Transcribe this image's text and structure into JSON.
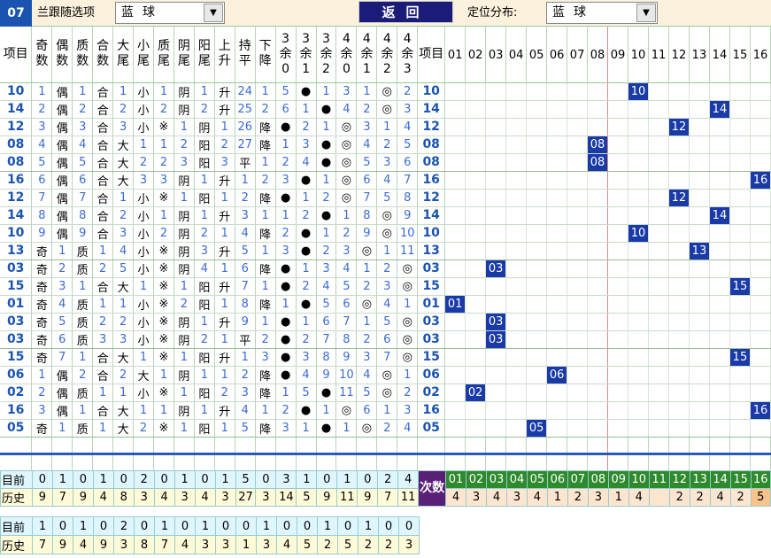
{
  "topbar": {
    "issue": "07",
    "title": "兰跟随选项",
    "ball_select": "蓝球",
    "back_label": "返回",
    "dist_label": "定位分布:",
    "dist_select": "蓝球",
    "arrow": "▼"
  },
  "headers": [
    "项目",
    "奇数",
    "偶数",
    "质数",
    "合数",
    "大尾",
    "小尾",
    "质尾",
    "阴尾",
    "阳尾",
    "上升",
    "持平",
    "下降",
    "3余0",
    "3余1",
    "3余2",
    "4余0",
    "4余1",
    "4余2",
    "4余3",
    "项目"
  ],
  "number_headers": [
    "01",
    "02",
    "03",
    "04",
    "05",
    "06",
    "07",
    "08",
    "09",
    "10",
    "11",
    "12",
    "13",
    "14",
    "15",
    "16"
  ],
  "rows": [
    {
      "no": "10",
      "c": [
        "1",
        "偶",
        "1",
        "合",
        "1",
        "小",
        "1",
        "阴",
        "1",
        "升",
        "24",
        "1",
        "5",
        "●",
        "1",
        "3",
        "1",
        "◎",
        "2"
      ]
    },
    {
      "no": "14",
      "c": [
        "2",
        "偶",
        "2",
        "合",
        "2",
        "小",
        "2",
        "阴",
        "2",
        "升",
        "25",
        "2",
        "6",
        "1",
        "●",
        "4",
        "2",
        "◎",
        "3"
      ]
    },
    {
      "no": "12",
      "c": [
        "3",
        "偶",
        "3",
        "合",
        "3",
        "小",
        "※",
        "1",
        "阴",
        "1",
        "26",
        "降",
        "●",
        "2",
        "1",
        "◎",
        "3",
        "1",
        "4"
      ]
    },
    {
      "no": "08",
      "c": [
        "4",
        "偶",
        "4",
        "合",
        "大",
        "1",
        "1",
        "2",
        "阳",
        "2",
        "27",
        "降",
        "1",
        "3",
        "●",
        "◎",
        "4",
        "2",
        "5"
      ]
    },
    {
      "no": "08",
      "c": [
        "5",
        "偶",
        "5",
        "合",
        "大",
        "2",
        "2",
        "3",
        "阳",
        "3",
        "平",
        "1",
        "2",
        "4",
        "●",
        "◎",
        "5",
        "3",
        "6"
      ]
    },
    {
      "no": "16",
      "c": [
        "6",
        "偶",
        "6",
        "合",
        "大",
        "3",
        "3",
        "阴",
        "1",
        "升",
        "1",
        "2",
        "3",
        "●",
        "1",
        "◎",
        "6",
        "4",
        "7"
      ]
    },
    {
      "no": "12",
      "c": [
        "7",
        "偶",
        "7",
        "合",
        "1",
        "小",
        "※",
        "1",
        "阳",
        "1",
        "2",
        "降",
        "●",
        "1",
        "2",
        "◎",
        "7",
        "5",
        "8"
      ]
    },
    {
      "no": "14",
      "c": [
        "8",
        "偶",
        "8",
        "合",
        "2",
        "小",
        "1",
        "阴",
        "1",
        "升",
        "3",
        "1",
        "1",
        "2",
        "●",
        "1",
        "8",
        "◎",
        "9"
      ]
    },
    {
      "no": "10",
      "c": [
        "9",
        "偶",
        "9",
        "合",
        "3",
        "小",
        "2",
        "阴",
        "2",
        "1",
        "4",
        "降",
        "2",
        "●",
        "1",
        "2",
        "9",
        "◎",
        "10"
      ]
    },
    {
      "no": "13",
      "c": [
        "奇",
        "1",
        "质",
        "1",
        "4",
        "小",
        "※",
        "阴",
        "3",
        "升",
        "5",
        "1",
        "3",
        "●",
        "2",
        "3",
        "◎",
        "1",
        "11"
      ]
    },
    {
      "no": "03",
      "c": [
        "奇",
        "2",
        "质",
        "2",
        "5",
        "小",
        "※",
        "阴",
        "4",
        "1",
        "6",
        "降",
        "●",
        "1",
        "3",
        "4",
        "1",
        "2",
        "◎"
      ]
    },
    {
      "no": "15",
      "c": [
        "奇",
        "3",
        "1",
        "合",
        "大",
        "1",
        "※",
        "1",
        "阳",
        "升",
        "7",
        "1",
        "●",
        "2",
        "4",
        "5",
        "2",
        "3",
        "◎"
      ]
    },
    {
      "no": "01",
      "c": [
        "奇",
        "4",
        "质",
        "1",
        "1",
        "小",
        "※",
        "2",
        "阳",
        "1",
        "8",
        "降",
        "1",
        "●",
        "5",
        "6",
        "◎",
        "4",
        "1"
      ]
    },
    {
      "no": "03",
      "c": [
        "奇",
        "5",
        "质",
        "2",
        "2",
        "小",
        "※",
        "阴",
        "1",
        "升",
        "9",
        "1",
        "●",
        "1",
        "6",
        "7",
        "1",
        "5",
        "◎"
      ]
    },
    {
      "no": "03",
      "c": [
        "奇",
        "6",
        "质",
        "3",
        "3",
        "小",
        "※",
        "阴",
        "2",
        "1",
        "平",
        "2",
        "●",
        "2",
        "7",
        "8",
        "2",
        "6",
        "◎"
      ]
    },
    {
      "no": "15",
      "c": [
        "奇",
        "7",
        "1",
        "合",
        "大",
        "1",
        "※",
        "1",
        "阳",
        "升",
        "1",
        "3",
        "●",
        "3",
        "8",
        "9",
        "3",
        "7",
        "◎"
      ]
    },
    {
      "no": "06",
      "c": [
        "1",
        "偶",
        "2",
        "合",
        "2",
        "大",
        "1",
        "阴",
        "1",
        "1",
        "2",
        "降",
        "●",
        "4",
        "9",
        "10",
        "4",
        "◎",
        "1"
      ]
    },
    {
      "no": "02",
      "c": [
        "2",
        "偶",
        "质",
        "1",
        "1",
        "小",
        "※",
        "1",
        "阳",
        "2",
        "3",
        "降",
        "1",
        "5",
        "●",
        "11",
        "5",
        "◎",
        "2"
      ]
    },
    {
      "no": "16",
      "c": [
        "3",
        "偶",
        "1",
        "合",
        "大",
        "1",
        "1",
        "阴",
        "1",
        "升",
        "4",
        "1",
        "2",
        "●",
        "1",
        "◎",
        "6",
        "1",
        "3"
      ]
    },
    {
      "no": "05",
      "c": [
        "奇",
        "1",
        "质",
        "1",
        "大",
        "2",
        "※",
        "1",
        "阳",
        "1",
        "5",
        "降",
        "3",
        "1",
        "●",
        "1",
        "◎",
        "2",
        "4"
      ]
    }
  ],
  "stats": {
    "label_now": "目前",
    "label_hist": "历史",
    "ci_label": "次数",
    "now": [
      "0",
      "1",
      "0",
      "1",
      "0",
      "2",
      "0",
      "1",
      "0",
      "1",
      "5",
      "0",
      "3",
      "1",
      "0",
      "1",
      "0",
      "2",
      "4"
    ],
    "hist": [
      "9",
      "7",
      "9",
      "4",
      "8",
      "3",
      "4",
      "3",
      "4",
      "3",
      "27",
      "3",
      "14",
      "5",
      "9",
      "11",
      "9",
      "7",
      "11"
    ],
    "numbers": [
      "01",
      "02",
      "03",
      "04",
      "05",
      "06",
      "07",
      "08",
      "09",
      "10",
      "11",
      "12",
      "13",
      "14",
      "15",
      "16"
    ],
    "counts": [
      "4",
      "3",
      "4",
      "3",
      "4",
      "1",
      "2",
      "3",
      "1",
      "4",
      "",
      "2",
      "2",
      "4",
      "2",
      "5"
    ]
  },
  "stats2": {
    "label_now": "目前",
    "label_hist": "历史",
    "now": [
      "1",
      "0",
      "1",
      "0",
      "2",
      "0",
      "1",
      "0",
      "1",
      "0",
      "0",
      "1",
      "0",
      "0",
      "1",
      "0",
      "1",
      "0",
      "0"
    ],
    "hist": [
      "7",
      "9",
      "4",
      "9",
      "3",
      "8",
      "7",
      "4",
      "3",
      "3",
      "1",
      "3",
      "4",
      "5",
      "2",
      "5",
      "2",
      "2",
      "3"
    ]
  },
  "colors": {
    "issue_blue": "#1b54b0",
    "hit_blue": "#1a3aa8",
    "back_bg": "#1b1b7a",
    "ci_purple": "#5a1f77",
    "num_green": "#2d8a2d",
    "top_bg": "#fbf1dc"
  }
}
